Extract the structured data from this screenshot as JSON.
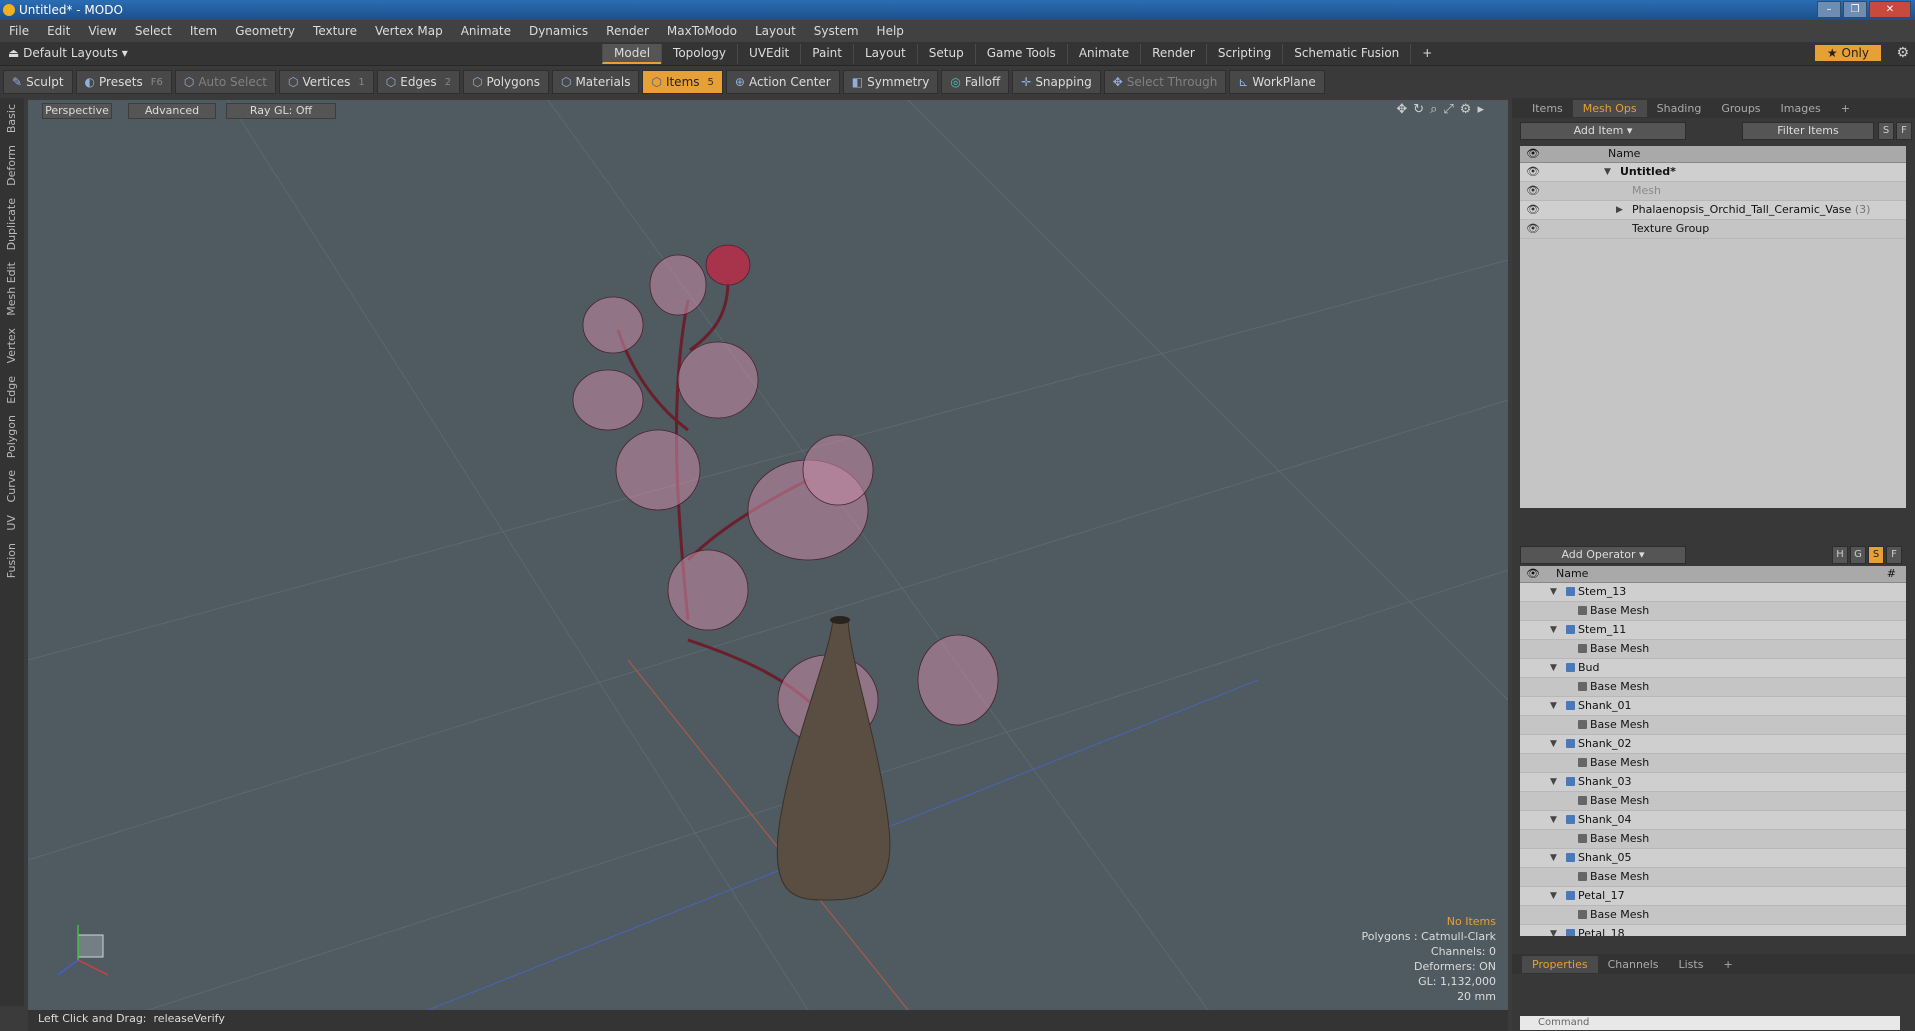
{
  "window": {
    "title": "Untitled* - MODO"
  },
  "menu": [
    "File",
    "Edit",
    "View",
    "Select",
    "Item",
    "Geometry",
    "Texture",
    "Vertex Map",
    "Animate",
    "Dynamics",
    "Render",
    "MaxToModo",
    "Layout",
    "System",
    "Help"
  ],
  "layout_selector": "Default Layouts",
  "tabs": [
    "Model",
    "Topology",
    "UVEdit",
    "Paint",
    "Layout",
    "Setup",
    "Game Tools",
    "Animate",
    "Render",
    "Scripting",
    "Schematic Fusion"
  ],
  "active_tab": "Model",
  "only_button": "Only",
  "toolbar": {
    "sculpt": "Sculpt",
    "presets": "Presets",
    "presets_key": "F6",
    "auto_select": "Auto Select",
    "vertices": "Vertices",
    "vertices_key": "1",
    "edges": "Edges",
    "edges_key": "2",
    "polygons": "Polygons",
    "materials": "Materials",
    "items": "Items",
    "items_key": "5",
    "action_center": "Action Center",
    "symmetry": "Symmetry",
    "falloff": "Falloff",
    "snapping": "Snapping",
    "select_through": "Select Through",
    "workplane": "WorkPlane"
  },
  "left_tabs": [
    "Basic",
    "Deform",
    "Duplicate",
    "Mesh Edit",
    "Vertex",
    "Edge",
    "Polygon",
    "Curve",
    "UV",
    "Fusion"
  ],
  "viewport": {
    "perspective": "Perspective",
    "advanced": "Advanced",
    "raygl": "Ray GL: Off",
    "info": {
      "no_items": "No Items",
      "polygons": "Polygons : Catmull-Clark",
      "channels": "Channels: 0",
      "deformers": "Deformers: ON",
      "gl": "GL: 1,132,000",
      "size": "20 mm"
    }
  },
  "status": {
    "hint": "Left Click and Drag:",
    "action": "releaseVerify"
  },
  "items_panel": {
    "tabs": [
      "Items",
      "Mesh Ops",
      "Shading",
      "Groups",
      "Images"
    ],
    "active": "Mesh Ops",
    "add_item": "Add Item",
    "filter": "Filter Items",
    "name_header": "Name",
    "s_btn": "S",
    "f_btn": "F",
    "tree": [
      {
        "label": "Untitled*",
        "indent": 0
      },
      {
        "label": "Mesh",
        "indent": 1
      },
      {
        "label": "Phalaenopsis_Orchid_Tall_Ceramic_Vase",
        "suffix": "(3)",
        "indent": 1
      },
      {
        "label": "Texture Group",
        "indent": 1
      }
    ]
  },
  "ops_panel": {
    "add_operator": "Add Operator",
    "name_header": "Name",
    "hash": "#",
    "btns": [
      "H",
      "G",
      "S",
      "F"
    ],
    "rows": [
      "Stem_13",
      "Base Mesh",
      "Stem_11",
      "Base Mesh",
      "Bud",
      "Base Mesh",
      "Shank_01",
      "Base Mesh",
      "Shank_02",
      "Base Mesh",
      "Shank_03",
      "Base Mesh",
      "Shank_04",
      "Base Mesh",
      "Shank_05",
      "Base Mesh",
      "Petal_17",
      "Base Mesh",
      "Petal_18"
    ]
  },
  "props_panel": {
    "tabs": [
      "Properties",
      "Channels",
      "Lists"
    ],
    "active": "Properties"
  },
  "command": "Command"
}
